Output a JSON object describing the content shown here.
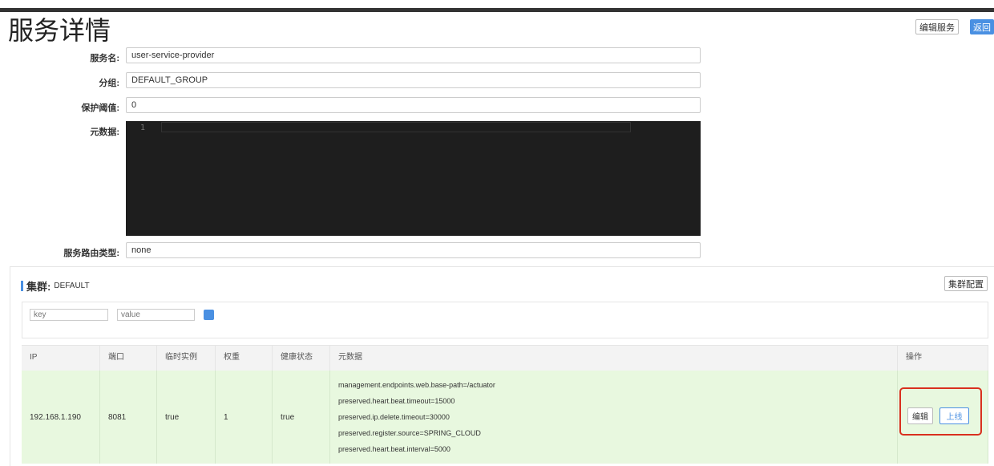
{
  "header": {
    "title": "服务详情",
    "edit_service_label": "编辑服务",
    "back_label": "返回"
  },
  "form": {
    "service_name": {
      "label": "服务名:",
      "value": "user-service-provider"
    },
    "group": {
      "label": "分组:",
      "value": "DEFAULT_GROUP"
    },
    "protect_threshold": {
      "label": "保护阈值:",
      "value": "0"
    },
    "metadata": {
      "label": "元数据:",
      "line_number": "1"
    },
    "route_type": {
      "label": "服务路由类型:",
      "value": "none"
    }
  },
  "cluster": {
    "label": "集群:",
    "name": "DEFAULT",
    "config_label": "集群配置",
    "filter": {
      "key_placeholder": "key",
      "value_placeholder": "value"
    },
    "table": {
      "headers": [
        "IP",
        "端口",
        "临时实例",
        "权重",
        "健康状态",
        "元数据",
        "操作"
      ],
      "rows": [
        {
          "ip": "192.168.1.190",
          "port": "8081",
          "ephemeral": "true",
          "weight": "1",
          "healthy": "true",
          "metadata": [
            "management.endpoints.web.base-path=/actuator",
            "preserved.heart.beat.timeout=15000",
            "preserved.ip.delete.timeout=30000",
            "preserved.register.source=SPRING_CLOUD",
            "preserved.heart.beat.interval=5000"
          ],
          "actions": {
            "edit": "编辑",
            "online": "上线"
          }
        }
      ]
    }
  },
  "colors": {
    "primary": "#4a90e2",
    "row_highlight": "#e8f8df",
    "editor_bg": "#1e1e1e",
    "annotation_red": "#d9301f"
  }
}
